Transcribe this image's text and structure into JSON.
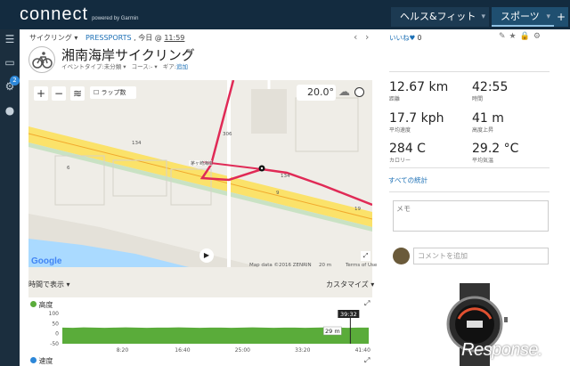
{
  "header": {
    "logo": "connect",
    "powered": "powered by Garmin",
    "nav": [
      {
        "label": "ヘルス&フィットネス"
      },
      {
        "label": "スポーツ"
      }
    ],
    "plus": "+"
  },
  "activity": {
    "type": "サイクリング",
    "pressports": "PRESSPORTS",
    "date_prefix": "今日 @",
    "time": "11:59",
    "title": "湘南海岸サイクリング",
    "event_label": "イベントタイプ:",
    "event_value": "未分類",
    "course_label": "コース:",
    "course_value": "-",
    "gear_label": "ギア:",
    "gear_value": "追加"
  },
  "map": {
    "lap_label": "ラップ数",
    "temperature": "20.0°",
    "google": "Google",
    "map_data": "Map data ©2016 ZENRIN",
    "scale": "20 m",
    "terms": "Terms of Use",
    "labels": [
      "134",
      "306",
      "6",
      "9",
      "19",
      "134",
      "茅ヶ崎海岸"
    ]
  },
  "chart_section": {
    "time_label": "時間で表示",
    "customize": "カスタマイズ",
    "altitude_label": "高度",
    "speed_label": "速度"
  },
  "chart_data": {
    "type": "area",
    "title": "高度",
    "x": [
      "8:20",
      "16:40",
      "25:00",
      "33:20",
      "41:40"
    ],
    "ylim": [
      -50,
      100
    ],
    "y_ticks": [
      100,
      50,
      0,
      -50
    ],
    "tooltip_time": "39:32",
    "tooltip_value": "29 m",
    "values": [
      30,
      29,
      31,
      30,
      29,
      30,
      31,
      30,
      29,
      30,
      30,
      31,
      30,
      29,
      30,
      30,
      29,
      30,
      31,
      30,
      29,
      30,
      30,
      29,
      30,
      31,
      30,
      29,
      30,
      30
    ],
    "color": "#5aac3a"
  },
  "right": {
    "likes": "いいね",
    "like_count": "0",
    "stats": [
      {
        "value": "12.67 km",
        "label": "距離"
      },
      {
        "value": "42:55",
        "label": "時間"
      },
      {
        "value": "17.7 kph",
        "label": "平均速度"
      },
      {
        "value": "41 m",
        "label": "高度上昇"
      },
      {
        "value": "284 C",
        "label": "カロリー"
      },
      {
        "value": "29.2 °C",
        "label": "平均気温"
      }
    ],
    "all_stats": "すべての統計",
    "memo": "メモ",
    "comment": "コメントを追加"
  },
  "watermark": "Response."
}
